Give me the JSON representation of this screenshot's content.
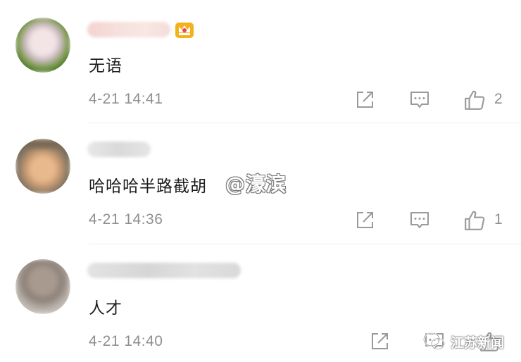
{
  "comments": [
    {
      "text": "无语",
      "time": "4-21 14:41",
      "likes": "2",
      "has_vip_badge": true,
      "icons": [
        "share-icon",
        "reply-icon",
        "thumbs-up-icon"
      ]
    },
    {
      "text": "哈哈哈半路截胡",
      "time": "4-21 14:36",
      "likes": "1",
      "has_vip_badge": false,
      "icons": [
        "share-icon",
        "reply-icon",
        "thumbs-up-icon"
      ]
    },
    {
      "text": "人才",
      "time": "4-21 14:40",
      "likes": "",
      "has_vip_badge": false,
      "icons": [
        "share-icon",
        "reply-icon",
        "thumbs-up-icon"
      ]
    }
  ],
  "watermark": "@濠滨",
  "source": "江苏新闻",
  "colors": {
    "text": "#1f1f1f",
    "meta": "#8f8f8f",
    "icon": "#9a9a9a",
    "divider": "#ececec",
    "badge": "#f3b21b"
  }
}
